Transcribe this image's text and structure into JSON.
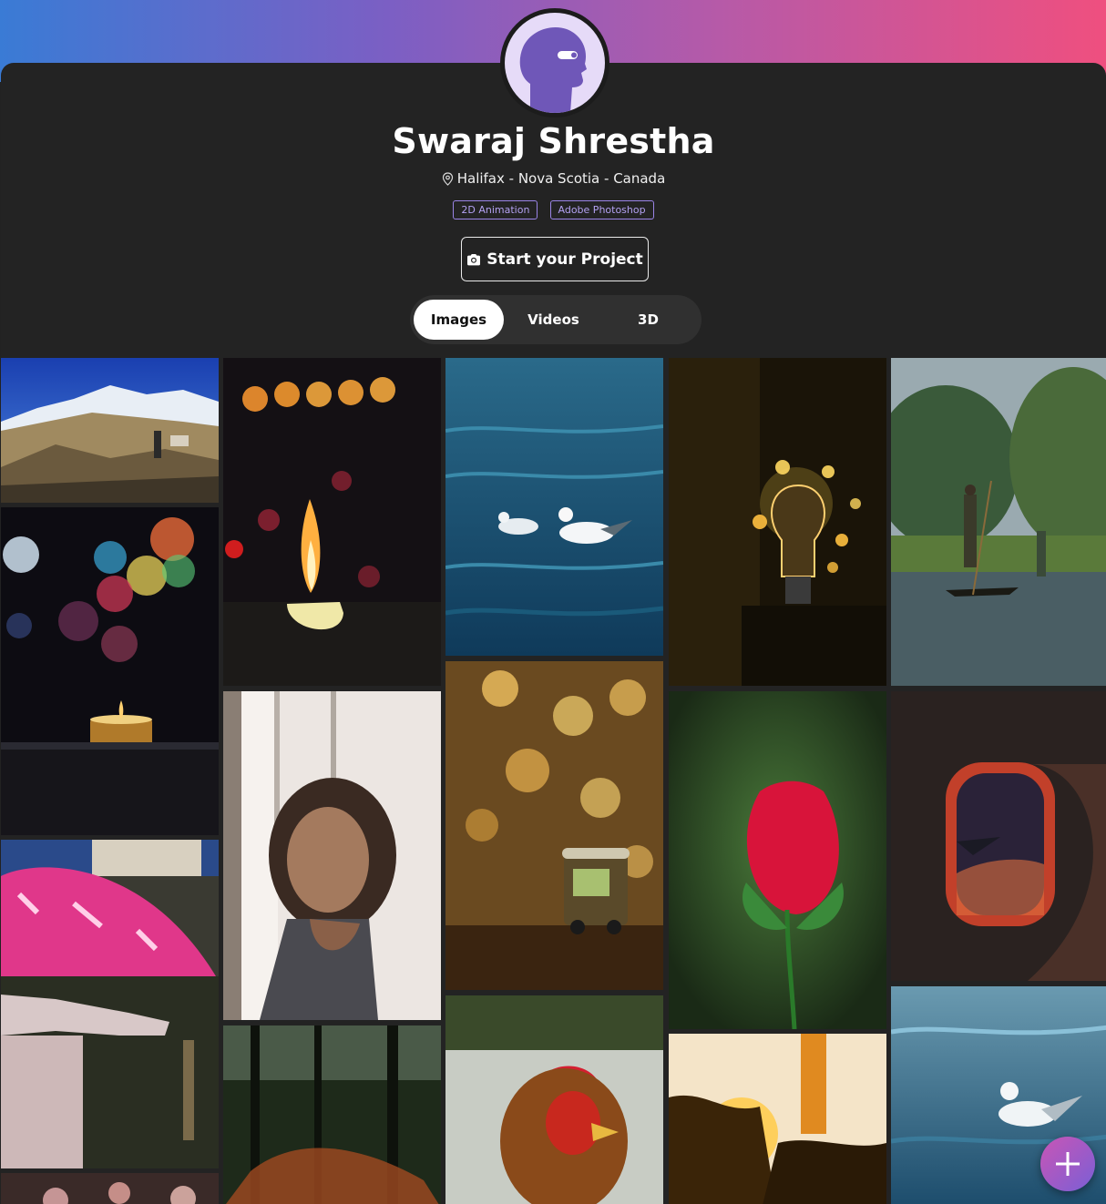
{
  "profile": {
    "name": "Swaraj Shrestha",
    "location": "Halifax - Nova Scotia - Canada",
    "tags": [
      "2D Animation",
      "Adobe Photoshop"
    ]
  },
  "cta": {
    "label": "Start your Project",
    "icon": "camera-icon"
  },
  "tabs": [
    {
      "label": "Images",
      "active": true
    },
    {
      "label": "Videos",
      "active": false
    },
    {
      "label": "3D",
      "active": false
    }
  ],
  "gallery": {
    "photos": [
      "mountain-hiker-photo",
      "candle-flame-photo",
      "seagulls-on-water-photo",
      "glowing-light-bulb-photo",
      "boatman-river-photo",
      "bokeh-tealight-photo",
      "woman-window-portrait-photo",
      "toy-rickshaw-bokeh-photo",
      "red-rose-photo",
      "airplane-window-photo",
      "pink-umbrella-child-photo",
      "forest-sunset-photo",
      "rooster-photo",
      "sunset-flowers-photo",
      "seagull-swimming-photo",
      "bokeh-lights-photo"
    ]
  },
  "fab": {
    "icon": "plus-icon"
  },
  "colors": {
    "accent": "#9a84e6",
    "header_gradient_start": "#3a7bd5",
    "header_gradient_end": "#ef4f7f",
    "card_bg": "#232323"
  }
}
